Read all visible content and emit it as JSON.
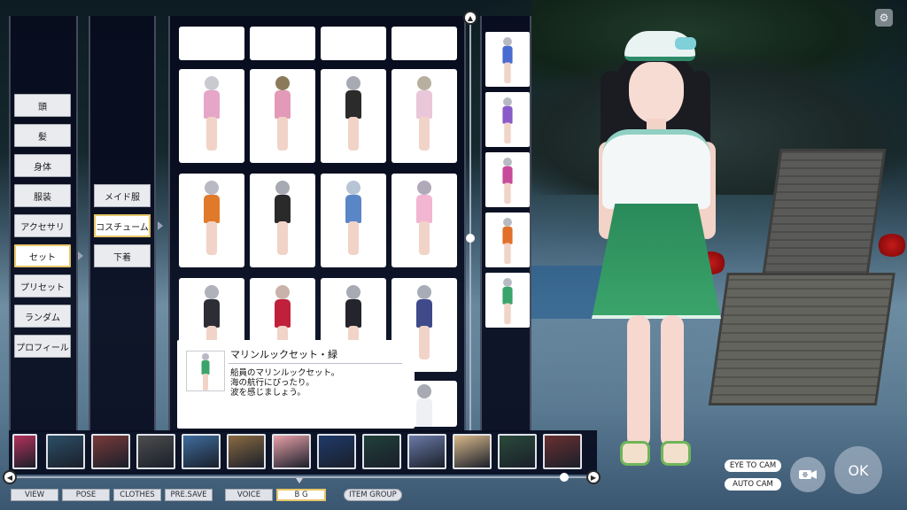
{
  "categories": [
    {
      "label": "頭"
    },
    {
      "label": "髪"
    },
    {
      "label": "身体"
    },
    {
      "label": "服装"
    },
    {
      "label": "アクセサリ"
    },
    {
      "label": "セット",
      "active": true
    },
    {
      "label": "プリセット"
    },
    {
      "label": "ランダム"
    },
    {
      "label": "プロフィール"
    }
  ],
  "subcategories": [
    {
      "label": "メイド服"
    },
    {
      "label": "コスチューム",
      "active": true
    },
    {
      "label": "下着"
    }
  ],
  "outfits": [
    {
      "hair": "#c9c9d0",
      "top": "#e6a6c8"
    },
    {
      "hair": "#8b7a5a",
      "top": "#e29ab8"
    },
    {
      "hair": "#a7aab2",
      "top": "#2b2b2b"
    },
    {
      "hair": "#b7b0a0",
      "top": "#e9c7d9"
    },
    {
      "hair": "#b9b9c4",
      "top": "#e07a2a"
    },
    {
      "hair": "#a7aab2",
      "top": "#2a2a2a"
    },
    {
      "hair": "#b7c4d6",
      "top": "#5a86c8"
    },
    {
      "hair": "#b0a9b8",
      "top": "#f2b6d2"
    },
    {
      "hair": "#b0b2ba",
      "top": "#2d2d35"
    },
    {
      "hair": "#c9b2aa",
      "top": "#c0203a"
    },
    {
      "hair": "#a7aab2",
      "top": "#24242c"
    },
    {
      "hair": "#a8acb6",
      "top": "#3e4a8a"
    }
  ],
  "side_thumbs": [
    {
      "top": "#4a6bd0"
    },
    {
      "top": "#8a5ac8"
    },
    {
      "top": "#c84a9a"
    },
    {
      "top": "#e0702a"
    },
    {
      "top": "#3aa46a"
    }
  ],
  "tooltip": {
    "title": "マリンルックセット・緑",
    "line1": "船員のマリンルックセット。",
    "line2": "海の航行にぴったり。",
    "line3": "波を感じましょう。"
  },
  "bg_thumbs": [
    {
      "color": "#b3325a"
    },
    {
      "color": "#2c4f66"
    },
    {
      "color": "#7a3a3a"
    },
    {
      "color": "#4d4d4d"
    },
    {
      "color": "#3f6d9e"
    },
    {
      "color": "#8a6a42"
    },
    {
      "color": "#e8a0a8"
    },
    {
      "color": "#1f3a6a"
    },
    {
      "color": "#20403a"
    },
    {
      "color": "#6a7aa6"
    },
    {
      "color": "#d8b88a"
    },
    {
      "color": "#2a4a3a"
    },
    {
      "color": "#6a3030"
    }
  ],
  "tabs": {
    "view": "VIEW",
    "pose": "POSE",
    "clothes": "CLOTHES",
    "pre_save": "PRE.SAVE",
    "voice": "VOICE",
    "bg": "B G",
    "item_group": "ITEM GROUP"
  },
  "camera": {
    "eye_to_cam": "EYE TO CAM",
    "auto_cam": "AUTO CAM",
    "ok": "OK"
  }
}
